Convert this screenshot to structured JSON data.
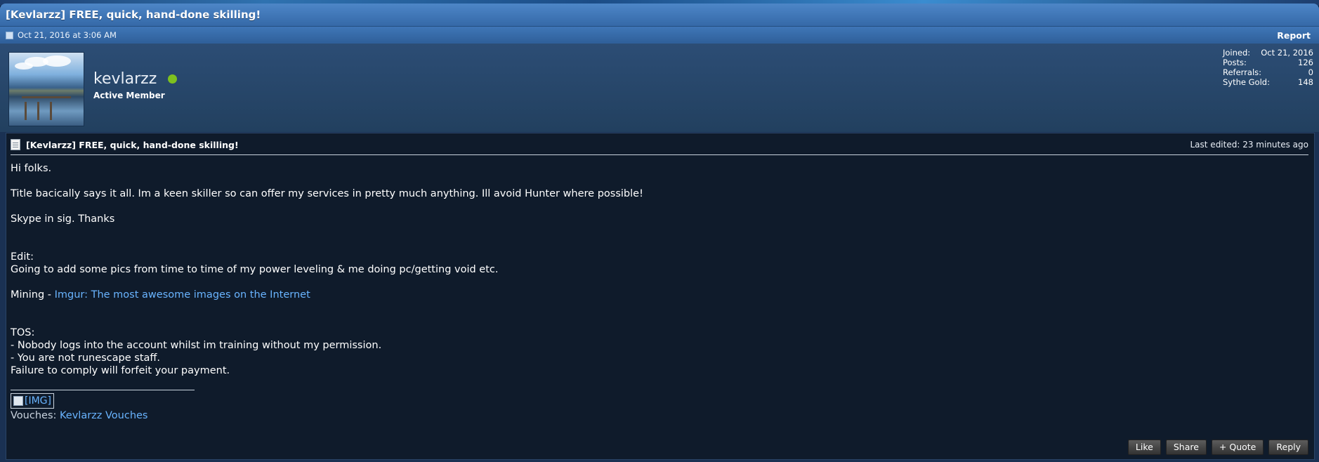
{
  "thread": {
    "title": "[Kevlarzz] FREE, quick, hand-done skilling!",
    "date": "Oct 21, 2016 at 3:06 AM",
    "report_label": "Report"
  },
  "user": {
    "name": "kevlarzz",
    "title": "Active Member",
    "online": true,
    "stats": [
      {
        "label": "Joined:",
        "value": "Oct 21, 2016"
      },
      {
        "label": "Posts:",
        "value": "126"
      },
      {
        "label": "Referrals:",
        "value": "0"
      },
      {
        "label": "Sythe Gold:",
        "value": "148"
      }
    ]
  },
  "post": {
    "title": "[Kevlarzz] FREE, quick, hand-done skilling!",
    "last_edited": "Last edited: 23 minutes ago",
    "lines": {
      "greeting": "Hi folks.",
      "intro": "Title bacically says it all. Im a keen skiller so can offer my services in pretty much anything. Ill avoid Hunter where possible!",
      "skype": "Skype in sig. Thanks",
      "edit": "Edit:",
      "edit_text": "Going to add some pics from time to time of my power leveling & me doing pc/getting void etc.",
      "mining_prefix": "Mining - ",
      "mining_link": "Imgur: The most awesome images on the Internet",
      "tos": "TOS:",
      "tos1": "- Nobody logs into the account whilst im training without my permission.",
      "tos2": "- You are not runescape staff.",
      "tos3": "Failure to comply will forfeit your payment."
    },
    "signature": {
      "img_label": "[IMG]",
      "vouches_label": "Vouches: ",
      "vouches_link": "Kevlarzz Vouches"
    },
    "actions": [
      "Like",
      "Share",
      "+ Quote",
      "Reply"
    ]
  },
  "colors": {
    "link": "#69b4ff",
    "online": "#7ec11f",
    "header_blue": "#3569a8"
  }
}
